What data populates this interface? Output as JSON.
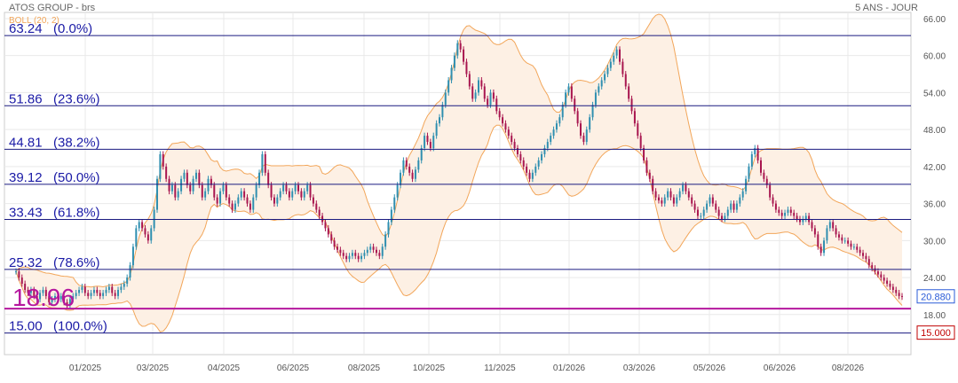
{
  "header": {
    "title": "ATOS GROUP - brs",
    "period": "5 ANS - JOUR",
    "indicator": "BOLL (20, 2)"
  },
  "colors": {
    "fib_line": "#1a1a80",
    "fib_text": "#1a1aa6",
    "support_line": "#b5179e",
    "band_line": "#f2a65a",
    "band_fill": "#fdf0e4",
    "candle_up": "#2f8fb0",
    "candle_down": "#a8164f",
    "last_price_box": "#2a5bd7",
    "level_box": "#c00000",
    "grid": "#e9e9e9",
    "axis_text": "#555555"
  },
  "chart_data": {
    "type": "candlestick",
    "title": "ATOS GROUP - brs",
    "period": "5 ANS - JOUR",
    "ylim": [
      11.5,
      67.0
    ],
    "yticks": [
      "66.00",
      "60.00",
      "54.00",
      "48.00",
      "42.00",
      "36.00",
      "30.00",
      "24.00",
      "18.00"
    ],
    "xticks": [
      "01/2025",
      "03/2025",
      "04/2025",
      "06/2025",
      "08/2025",
      "10/2025",
      "11/2025",
      "01/2026",
      "03/2026",
      "05/2026",
      "06/2026",
      "08/2026"
    ],
    "grid": true,
    "fib_levels": [
      {
        "price": 63.24,
        "label": "63.24",
        "pct": "(0.0%)"
      },
      {
        "price": 51.86,
        "label": "51.86",
        "pct": "(23.6%)"
      },
      {
        "price": 44.81,
        "label": "44.81",
        "pct": "(38.2%)"
      },
      {
        "price": 39.12,
        "label": "39.12",
        "pct": "(50.0%)"
      },
      {
        "price": 33.43,
        "label": "33.43",
        "pct": "(61.8%)"
      },
      {
        "price": 25.32,
        "label": "25.32",
        "pct": "(78.6%)"
      },
      {
        "price": 15.0,
        "label": "15.00",
        "pct": "(100.0%)"
      }
    ],
    "support": {
      "price": 18.96,
      "label": "18.96"
    },
    "last_price": {
      "price": 20.88,
      "label": "20.880"
    },
    "level_tag": {
      "price": 15.0,
      "label": "15.000"
    },
    "closes": [
      25.0,
      24.0,
      23.0,
      22.0,
      21.5,
      22.0,
      21.0,
      20.5,
      21.5,
      22.0,
      21.0,
      20.0,
      20.5,
      21.0,
      20.5,
      21.0,
      20.0,
      19.5,
      20.5,
      21.0,
      21.5,
      22.0,
      22.5,
      21.5,
      21.0,
      21.5,
      22.0,
      21.5,
      21.0,
      21.5,
      22.0,
      22.5,
      21.5,
      21.0,
      22.0,
      22.5,
      23.0,
      24.0,
      26.0,
      29.0,
      32.0,
      33.0,
      32.0,
      31.0,
      30.0,
      32.0,
      35.0,
      40.0,
      44.0,
      42.0,
      40.0,
      38.0,
      39.0,
      37.0,
      38.0,
      40.0,
      41.0,
      39.0,
      38.0,
      40.0,
      41.0,
      39.0,
      37.0,
      38.0,
      40.0,
      39.0,
      37.0,
      36.0,
      38.0,
      39.0,
      37.0,
      36.0,
      35.0,
      36.0,
      37.0,
      38.0,
      37.0,
      36.0,
      35.0,
      37.0,
      39.0,
      41.0,
      44.0,
      41.0,
      39.0,
      37.0,
      36.0,
      37.0,
      38.0,
      39.0,
      38.0,
      37.0,
      38.0,
      39.0,
      38.0,
      37.0,
      38.0,
      39.0,
      37.0,
      36.0,
      35.0,
      34.0,
      33.0,
      32.0,
      31.0,
      30.0,
      29.0,
      28.5,
      28.0,
      27.5,
      27.0,
      27.5,
      28.0,
      27.5,
      27.0,
      27.5,
      28.0,
      28.5,
      29.0,
      28.5,
      28.0,
      27.5,
      29.0,
      31.0,
      33.0,
      35.0,
      37.0,
      39.0,
      41.0,
      43.0,
      42.0,
      41.0,
      40.0,
      41.5,
      43.0,
      45.0,
      47.0,
      46.0,
      45.0,
      47.0,
      49.0,
      50.0,
      52.0,
      54.0,
      56.0,
      58.0,
      60.0,
      62.0,
      61.0,
      59.0,
      57.0,
      55.0,
      53.0,
      54.0,
      56.0,
      55.0,
      53.0,
      52.0,
      54.0,
      53.0,
      51.0,
      50.0,
      49.0,
      48.0,
      47.0,
      46.0,
      45.0,
      44.0,
      43.0,
      42.0,
      41.0,
      40.0,
      41.0,
      42.0,
      43.0,
      44.0,
      45.0,
      46.0,
      47.0,
      48.0,
      49.0,
      50.0,
      52.0,
      54.0,
      55.0,
      53.0,
      51.0,
      49.0,
      47.0,
      46.0,
      48.0,
      50.0,
      52.0,
      54.0,
      55.0,
      56.0,
      57.0,
      58.0,
      59.0,
      60.0,
      61.0,
      59.0,
      57.0,
      55.0,
      53.0,
      51.0,
      49.0,
      47.0,
      45.0,
      43.0,
      41.0,
      40.0,
      38.0,
      37.0,
      36.5,
      36.0,
      37.0,
      38.0,
      37.0,
      36.0,
      37.0,
      38.0,
      39.0,
      38.0,
      37.0,
      36.0,
      35.0,
      34.0,
      34.0,
      35.0,
      36.0,
      37.0,
      36.0,
      35.0,
      34.0,
      33.5,
      34.0,
      35.0,
      36.0,
      35.0,
      36.0,
      37.0,
      38.0,
      40.0,
      42.0,
      44.0,
      45.0,
      43.0,
      41.0,
      40.0,
      39.0,
      37.0,
      36.0,
      35.0,
      34.5,
      34.0,
      34.5,
      35.0,
      34.5,
      34.0,
      33.5,
      33.0,
      33.5,
      34.0,
      33.0,
      32.0,
      31.0,
      29.0,
      28.0,
      30.0,
      32.0,
      33.0,
      32.0,
      31.0,
      30.5,
      30.0,
      30.0,
      29.5,
      29.0,
      29.0,
      28.5,
      28.0,
      27.5,
      27.0,
      26.0,
      25.5,
      25.0,
      24.5,
      24.0,
      23.5,
      23.0,
      22.5,
      22.0,
      21.5,
      21.0,
      20.88
    ]
  }
}
